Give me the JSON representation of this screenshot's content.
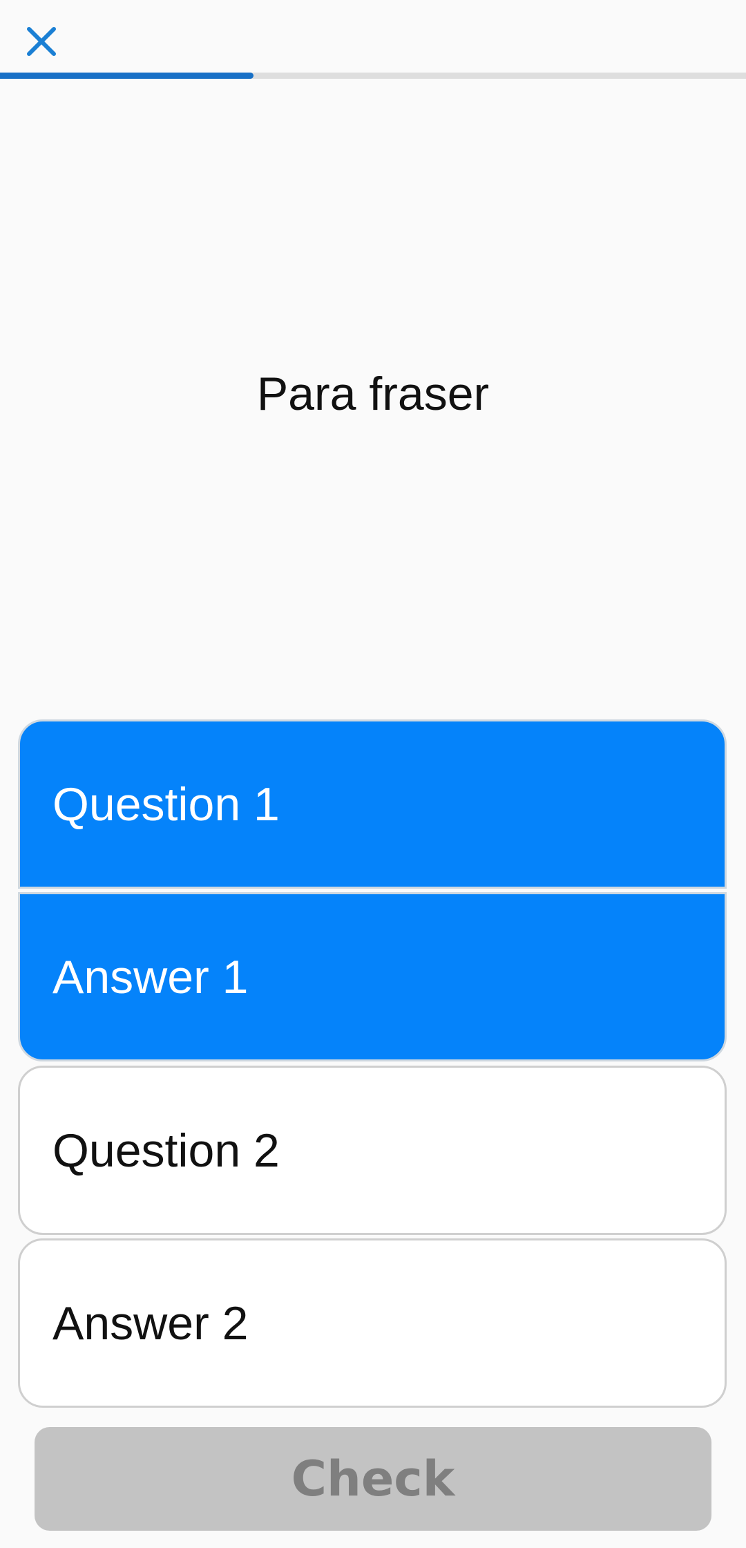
{
  "header": {
    "close_icon": "close-icon",
    "accent_color": "#1870c6",
    "progress": 0.34
  },
  "prompt": {
    "title": "Para fraser"
  },
  "options": [
    {
      "label": "Question 1",
      "selected": true
    },
    {
      "label": "Answer 1",
      "selected": true
    },
    {
      "label": "Question 2",
      "selected": false
    },
    {
      "label": "Answer 2",
      "selected": false
    }
  ],
  "colors": {
    "selected_bg": "#0583fa",
    "unselected_bg": "#ffffff",
    "check_disabled_bg": "#c3c3c3",
    "check_disabled_text": "#7f7f7f"
  },
  "check_button": {
    "label": "Check",
    "enabled": false
  }
}
